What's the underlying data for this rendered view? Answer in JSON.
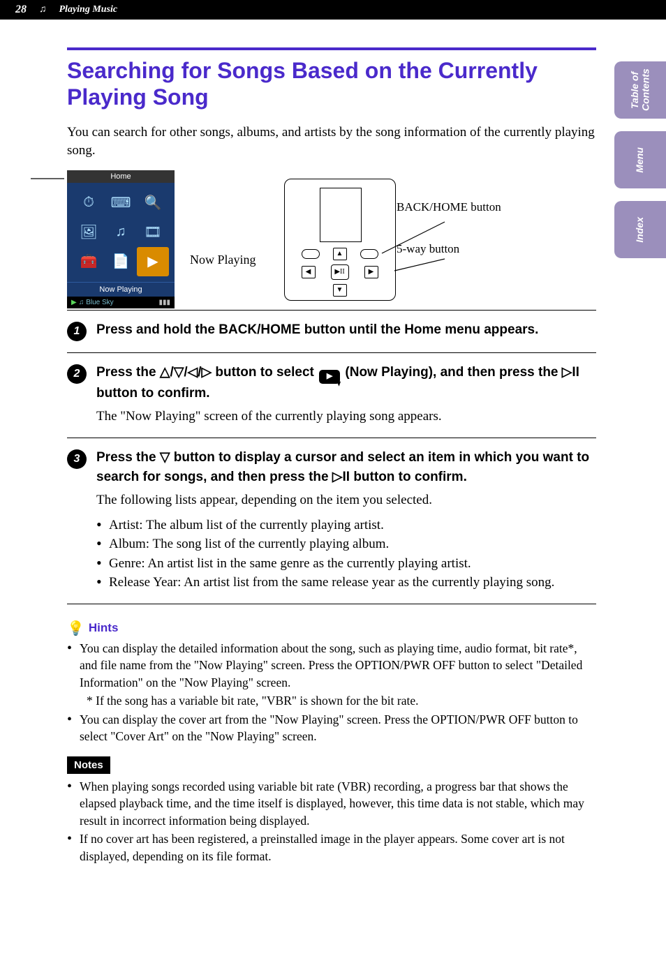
{
  "header": {
    "page_number": "28",
    "section_title": "Playing Music"
  },
  "side_tabs": {
    "toc": "Table of\nContents",
    "menu": "Menu",
    "index": "Index"
  },
  "title": "Searching for Songs Based on the Currently Playing Song",
  "intro": "You can search for other songs, albums, and artists by the song information of the currently playing song.",
  "home_screen": {
    "title": "Home",
    "selected_label": "Now Playing",
    "footer_song": "Blue Sky"
  },
  "callouts": {
    "now_playing": "Now Playing",
    "back_home": "BACK/HOME button",
    "five_way": "5-way button"
  },
  "steps": [
    {
      "num": "1",
      "heading": "Press and hold the BACK/HOME button until the Home menu appears."
    },
    {
      "num": "2",
      "heading_parts": {
        "a": "Press the ",
        "b": " button to select ",
        "c": " (Now Playing), and then press the ",
        "d": " button to confirm."
      },
      "direction_glyphs": "△/▽/◁/▷",
      "play_glyph": "▷II",
      "body": "The \"Now Playing\" screen of the currently playing song appears."
    },
    {
      "num": "3",
      "heading_parts": {
        "a": "Press the ",
        "b": " button to display a cursor and select an item in which you want to search for songs, and then press the ",
        "c": " button to confirm."
      },
      "down_glyph": "▽",
      "play_glyph": "▷II",
      "body": "The following lists appear, depending on the item you selected.",
      "bullets": [
        "Artist: The album list of the currently playing artist.",
        "Album: The song list of the currently playing album.",
        "Genre: An artist list in the same genre as the currently playing artist.",
        "Release Year: An artist list from the same release year as the currently playing song."
      ]
    }
  ],
  "hints": {
    "label": "Hints",
    "items": [
      "You can display the detailed information about the song, such as playing time, audio format, bit rate*, and file name from the \"Now Playing\" screen. Press the OPTION/PWR OFF button to select \"Detailed Information\" on the \"Now Playing\" screen.",
      "You can display the cover art from the \"Now Playing\" screen. Press the OPTION/PWR OFF button to select \"Cover Art\" on the \"Now Playing\" screen."
    ],
    "footnote": "* If the song has a variable bit rate, \"VBR\" is shown for the bit rate."
  },
  "notes": {
    "label": "Notes",
    "items": [
      "When playing songs recorded using variable bit rate (VBR) recording, a progress bar that shows the elapsed playback time, and the time itself is displayed, however, this time data is not stable, which may result in incorrect information being displayed.",
      "If no cover art has been registered, a preinstalled image in the player appears. Some cover art is not displayed, depending on its file format."
    ]
  }
}
